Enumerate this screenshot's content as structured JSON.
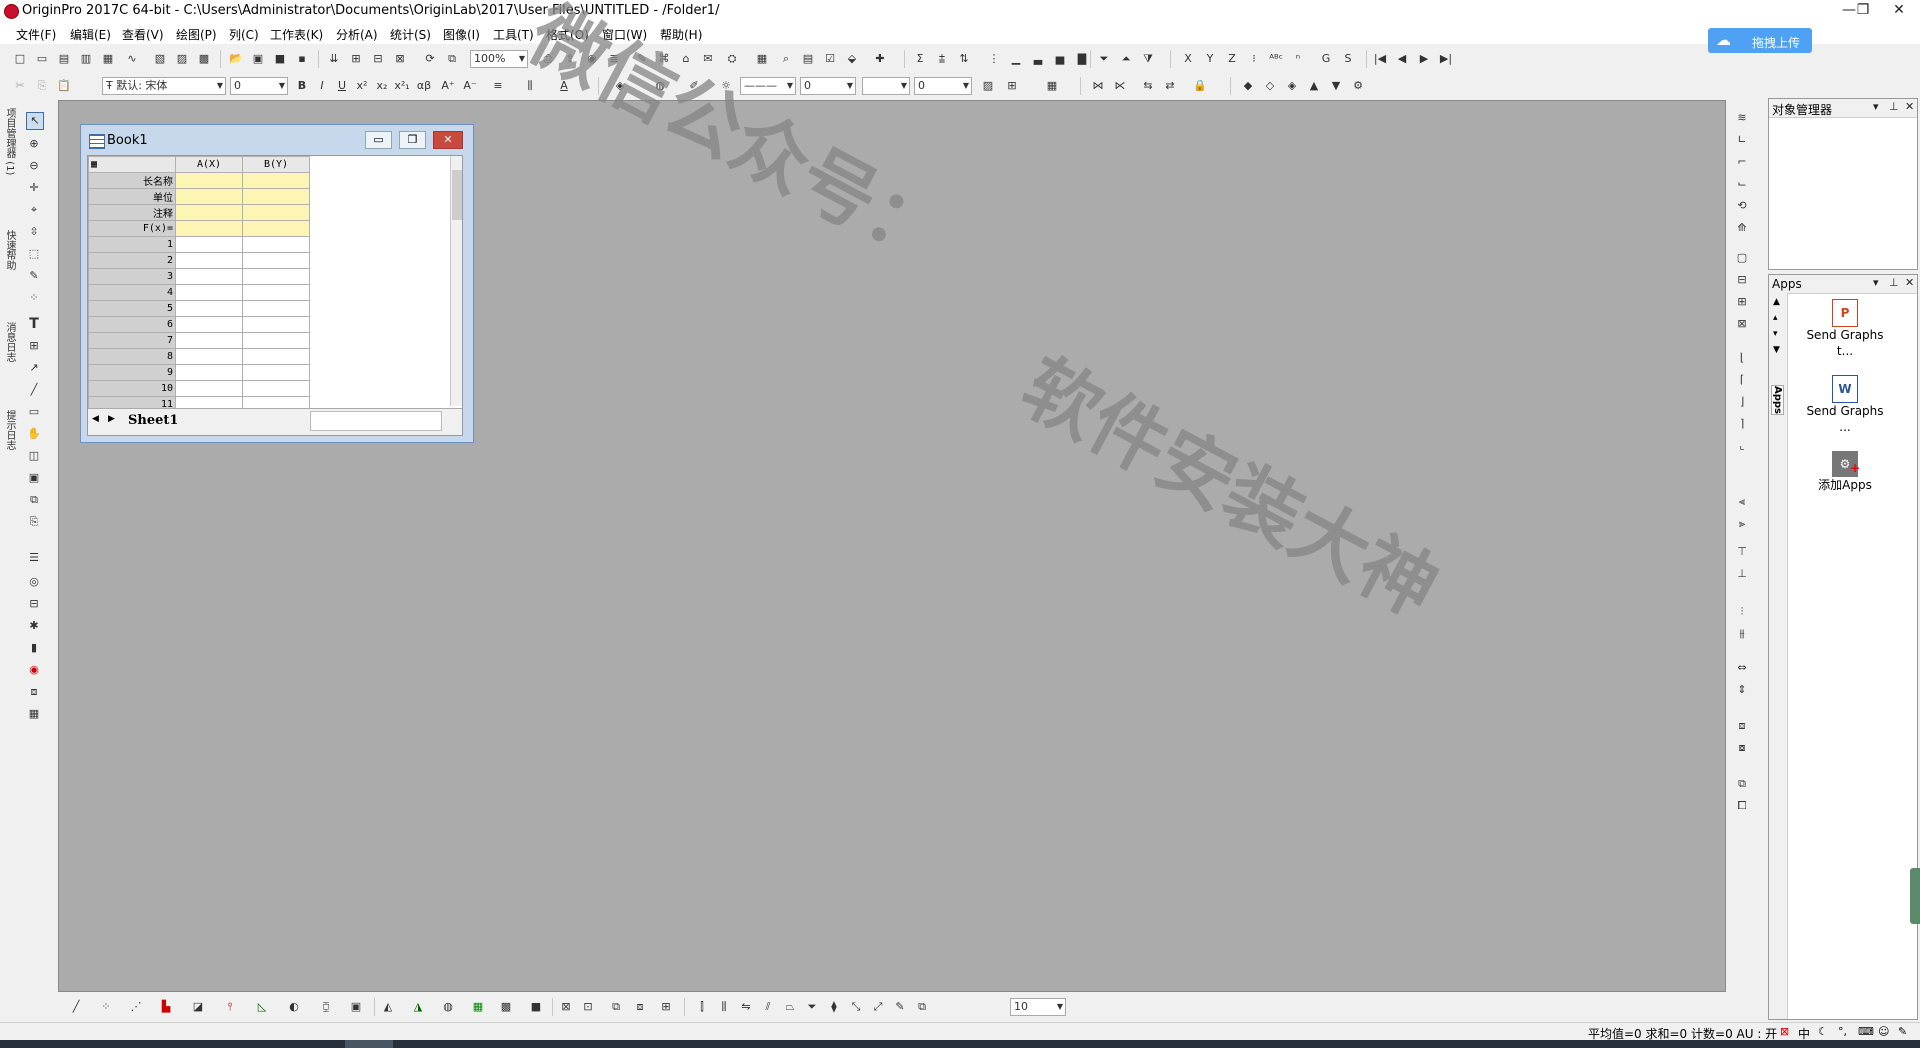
{
  "window": {
    "title": "OriginPro 2017C 64-bit - C:\\Users\\Administrator\\Documents\\OriginLab\\2017\\User Files\\UNTITLED - /Folder1/",
    "minimize": "—",
    "restore": "❐",
    "close": "✕"
  },
  "menu": [
    "文件(F)",
    "编辑(E)",
    "查看(V)",
    "绘图(P)",
    "列(C)",
    "工作表(K)",
    "分析(A)",
    "统计(S)",
    "图像(I)",
    "工具(T)",
    "格式(O)",
    "窗口(W)",
    "帮助(H)"
  ],
  "upload": {
    "label": "拖拽上传",
    "icon": "cloud-icon"
  },
  "toolbar": {
    "zoom": "100%",
    "font_name": "默认: 宋体",
    "font_size": "0",
    "line_width": "0",
    "pattern_value": "0",
    "bottom_size": "10",
    "letters": [
      "X",
      "Y",
      "Z",
      "G",
      "S"
    ]
  },
  "left_dock": {
    "tabs": [
      "项目管理器 (1)",
      "快速帮助",
      "消息日志",
      "提示日志"
    ]
  },
  "object_manager": {
    "title": "对象管理器"
  },
  "apps_panel": {
    "title": "Apps",
    "side_tab": "Apps",
    "items": [
      {
        "label": "Send Graphs t...",
        "icon": "powerpoint-icon"
      },
      {
        "label": "Send Graphs ...",
        "icon": "word-icon"
      },
      {
        "label": "添加Apps",
        "icon": "add-apps-icon"
      }
    ]
  },
  "book": {
    "title": "Book1",
    "columns": [
      "A(X)",
      "B(Y)"
    ],
    "label_rows": [
      "长名称",
      "单位",
      "注释",
      "F(x)="
    ],
    "rows": [
      "1",
      "2",
      "3",
      "4",
      "5",
      "6",
      "7",
      "8",
      "9",
      "10",
      "11"
    ],
    "sheet_tab": "Sheet1"
  },
  "status": {
    "text": "平均值=0 求和=0 计数=0   AU : 开",
    "ime": "中"
  },
  "watermark": {
    "line1": "微信公众号：",
    "line2": "软件安装大神"
  }
}
